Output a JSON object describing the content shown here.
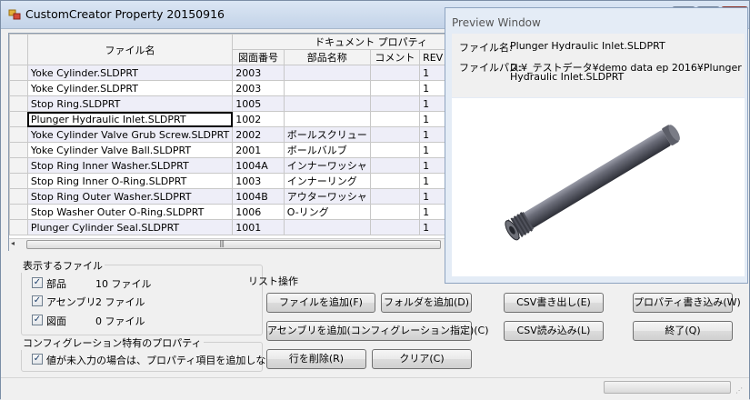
{
  "window": {
    "title": "CustomCreator Property 20150916"
  },
  "grid": {
    "header_filename": "ファイル名",
    "header_group": "ドキュメント プロパティ",
    "columns": [
      "図面番号",
      "部品名称",
      "コメント",
      "REV"
    ],
    "rows": [
      {
        "file": "Yoke Cylinder.SLDPRT",
        "drawing_no": "2003",
        "part_name": "",
        "comment": "",
        "rev": "1"
      },
      {
        "file": "Yoke Cylinder.SLDPRT",
        "drawing_no": "2003",
        "part_name": "",
        "comment": "",
        "rev": "1"
      },
      {
        "file": "Stop Ring.SLDPRT",
        "drawing_no": "1005",
        "part_name": "",
        "comment": "",
        "rev": "1"
      },
      {
        "file": "Plunger Hydraulic Inlet.SLDPRT",
        "drawing_no": "1002",
        "part_name": "",
        "comment": "",
        "rev": "1"
      },
      {
        "file": "Yoke Cylinder Valve Grub Screw.SLDPRT",
        "drawing_no": "2002",
        "part_name": "ボールスクリュー",
        "comment": "",
        "rev": "1"
      },
      {
        "file": "Yoke Cylinder Valve Ball.SLDPRT",
        "drawing_no": "2001",
        "part_name": "ボールバルブ",
        "comment": "",
        "rev": "1"
      },
      {
        "file": "Stop Ring Inner Washer.SLDPRT",
        "drawing_no": "1004A",
        "part_name": "インナーワッシャ",
        "comment": "",
        "rev": "1"
      },
      {
        "file": "Stop Ring Inner O-Ring.SLDPRT",
        "drawing_no": "1003",
        "part_name": "インナーリング",
        "comment": "",
        "rev": "1"
      },
      {
        "file": "Stop Ring Outer Washer.SLDPRT",
        "drawing_no": "1004B",
        "part_name": "アウターワッシャ",
        "comment": "",
        "rev": "1"
      },
      {
        "file": "Stop Washer Outer O-Ring.SLDPRT",
        "drawing_no": "1006",
        "part_name": "O-リング",
        "comment": "",
        "rev": "1"
      },
      {
        "file": "Plunger Cylinder Seal.SLDPRT",
        "drawing_no": "1001",
        "part_name": "",
        "comment": "",
        "rev": "1"
      }
    ],
    "scroll_left": "◂",
    "scroll_grip": "|||"
  },
  "display_files": {
    "title": "表示するファイル",
    "items": [
      {
        "label": "部品",
        "count": "10 ファイル",
        "checked": "✓"
      },
      {
        "label": "アセンブリ",
        "count": "2 ファイル",
        "checked": "✓"
      },
      {
        "label": "図面",
        "count": "0 ファイル",
        "checked": "✓"
      }
    ]
  },
  "config_props": {
    "title": "コンフィグレーション特有のプロパティ",
    "option_label": "値が未入力の場合は、プロパティ項目を追加しない",
    "checked": "✓"
  },
  "list_ops": {
    "title": "リスト操作",
    "add_file": "ファイルを追加(F)",
    "add_folder": "フォルダを追加(D)",
    "add_assembly": "アセンブリを追加(コンフィグレーション指定)(C)",
    "delete_row": "行を削除(R)",
    "clear": "クリア(C)",
    "csv_export": "CSV書き出し(E)",
    "csv_import": "CSV読み込み(L)",
    "write_props": "プロパティ書き込み(W)",
    "exit": "終了(Q)"
  },
  "preview": {
    "title": "Preview Window",
    "file_name_label": "ファイル名:",
    "file_name": "Plunger Hydraulic Inlet.SLDPRT",
    "file_path_label": "ファイルパス:",
    "file_path_line1": "D:¥_テストデータ¥demo data ep 2016¥Plunger",
    "file_path_line2": "Hydraulic Inlet.SLDPRT"
  },
  "colors": {
    "selection_outline": "#000000",
    "alt_row": "#eeeef8",
    "title_bar": "#c3d3e8"
  }
}
